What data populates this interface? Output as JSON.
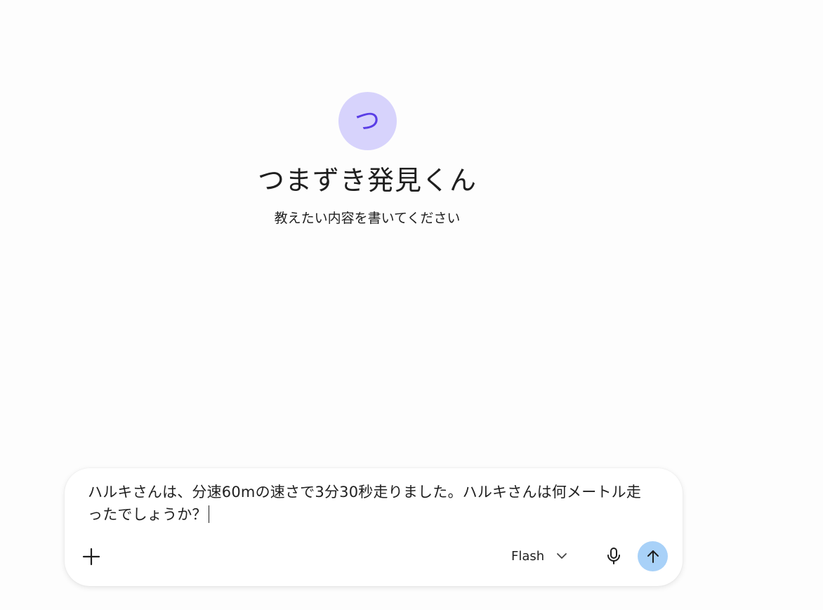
{
  "app": {
    "avatar_glyph": "つ",
    "title": "つまずき発見くん",
    "subtitle": "教えたい内容を書いてください"
  },
  "composer": {
    "input_value": "ハルキさんは、分速60mの速さで3分30秒走りました。ハルキさんは何メートル走ったでしょうか？",
    "add_icon": "plus-icon",
    "model_label": "Flash",
    "model_dropdown_icon": "chevron-down-icon",
    "mic_icon": "microphone-icon",
    "send_icon": "arrow-up-icon"
  },
  "colors": {
    "background": "#fdfdfd",
    "avatar_bg": "#d7d3fc",
    "avatar_fg": "#5a3ee6",
    "send_button_bg": "#a8d1f8",
    "text": "#1f1f1f"
  }
}
